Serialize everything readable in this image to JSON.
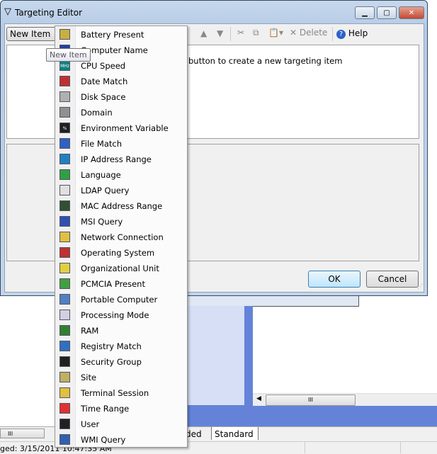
{
  "window": {
    "title": "Targeting Editor",
    "minimize": "▁",
    "maximize": "▢",
    "close": "✕"
  },
  "toolbar": {
    "new_item": "New Item",
    "delete": "Delete",
    "help": "Help"
  },
  "tooltip": "New Item",
  "main": {
    "hint": "button to create a new targeting item"
  },
  "buttons": {
    "ok": "OK",
    "cancel": "Cancel"
  },
  "menu": {
    "items": [
      {
        "label": "Battery Present",
        "icon": "battery-icon",
        "color": "#c8b040"
      },
      {
        "label": "Computer Name",
        "icon": "computer-icon",
        "color": "#2040a0"
      },
      {
        "label": "CPU Speed",
        "icon": "cpu-icon",
        "color": "#108080",
        "text": "MHz"
      },
      {
        "label": "Date Match",
        "icon": "calendar-icon",
        "color": "#c03030"
      },
      {
        "label": "Disk Space",
        "icon": "disk-icon",
        "color": "#b0b0b0"
      },
      {
        "label": "Domain",
        "icon": "domain-icon",
        "color": "#909090"
      },
      {
        "label": "Environment Variable",
        "icon": "env-variable-icon",
        "color": "#202020",
        "text": "%"
      },
      {
        "label": "File Match",
        "icon": "file-icon",
        "color": "#3060c0"
      },
      {
        "label": "IP Address Range",
        "icon": "network-icon",
        "color": "#2080c0"
      },
      {
        "label": "Language",
        "icon": "globe-icon",
        "color": "#30a040"
      },
      {
        "label": "LDAP Query",
        "icon": "ldap-icon",
        "color": "#e0e0e0"
      },
      {
        "label": "MAC Address Range",
        "icon": "network-card-icon",
        "color": "#305030"
      },
      {
        "label": "MSI Query",
        "icon": "msi-icon",
        "color": "#3050b0"
      },
      {
        "label": "Network Connection",
        "icon": "network-connection-icon",
        "color": "#e0c040"
      },
      {
        "label": "Operating System",
        "icon": "os-icon",
        "color": "#c03030"
      },
      {
        "label": "Organizational Unit",
        "icon": "ou-folder-icon",
        "color": "#e0d040"
      },
      {
        "label": "PCMCIA Present",
        "icon": "pcmcia-icon",
        "color": "#40a040"
      },
      {
        "label": "Portable Computer",
        "icon": "laptop-icon",
        "color": "#5080c0"
      },
      {
        "label": "Processing Mode",
        "icon": "processing-mode-icon",
        "color": "#d0d0e0"
      },
      {
        "label": "RAM",
        "icon": "ram-icon",
        "color": "#308030"
      },
      {
        "label": "Registry Match",
        "icon": "registry-icon",
        "color": "#3070c0"
      },
      {
        "label": "Security Group",
        "icon": "security-group-icon",
        "color": "#202020"
      },
      {
        "label": "Site",
        "icon": "site-icon",
        "color": "#c0b060"
      },
      {
        "label": "Terminal Session",
        "icon": "terminal-session-icon",
        "color": "#e0c040"
      },
      {
        "label": "Time Range",
        "icon": "clock-icon",
        "color": "#e03030"
      },
      {
        "label": "User",
        "icon": "user-icon",
        "color": "#202020"
      },
      {
        "label": "WMI Query",
        "icon": "wmi-icon",
        "color": "#3060b0"
      }
    ]
  },
  "background": {
    "tab_partial": "ded",
    "tab_standard": "Standard",
    "status": "ged: 3/15/2011 10:47:35 AM",
    "scroll_grip": "III"
  }
}
